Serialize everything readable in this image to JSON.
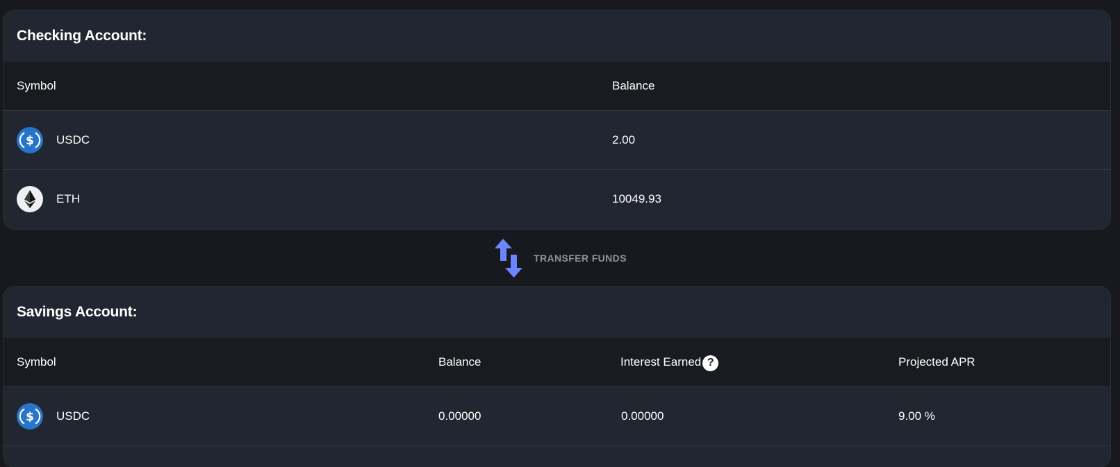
{
  "checking": {
    "title": "Checking Account:",
    "columns": {
      "symbol": "Symbol",
      "balance": "Balance"
    },
    "rows": [
      {
        "icon": "usdc-icon",
        "symbol": "USDC",
        "balance": "2.00"
      },
      {
        "icon": "eth-icon",
        "symbol": "ETH",
        "balance": "10049.93"
      }
    ]
  },
  "transfer": {
    "label": "TRANSFER FUNDS",
    "icon": "swap-vertical-arrows-icon"
  },
  "savings": {
    "title": "Savings Account:",
    "columns": {
      "symbol": "Symbol",
      "balance": "Balance",
      "interest": "Interest Earned",
      "apr": "Projected APR"
    },
    "help_icon": "?",
    "rows": [
      {
        "icon": "usdc-icon",
        "symbol": "USDC",
        "balance": "0.00000",
        "interest": "0.00000",
        "apr": "9.00 %"
      }
    ]
  },
  "colors": {
    "page_bg": "#17191e",
    "card_bg": "#222630",
    "header_bg": "#191b20",
    "usdc_blue": "#2775ca",
    "transfer_arrow": "#6b86ff",
    "muted_text": "#8d929f"
  }
}
